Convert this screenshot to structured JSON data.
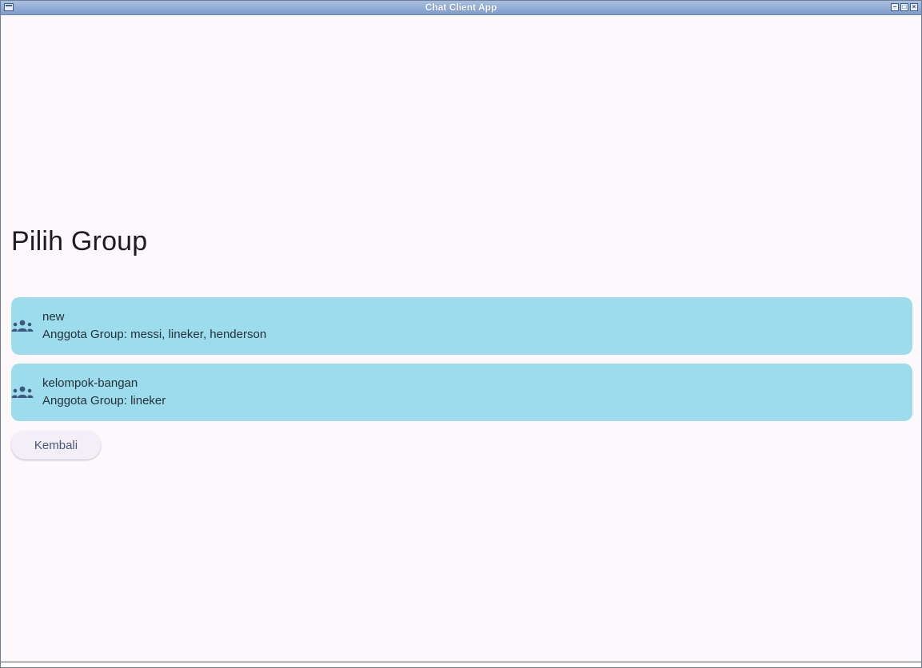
{
  "window": {
    "title": "Chat Client App"
  },
  "page": {
    "title": "Pilih Group"
  },
  "groups": [
    {
      "name": "new",
      "members": "Anggota Group: messi, lineker, henderson",
      "icon": "group-icon"
    },
    {
      "name": "kelompok-bangan",
      "members": "Anggota Group: lineker",
      "icon": "group-icon"
    }
  ],
  "actions": {
    "back_label": "Kembali"
  },
  "colors": {
    "card_background": "#9cdcec",
    "page_background": "#fdf8fc",
    "icon_color": "#3f5680",
    "button_background": "#f3eef8"
  }
}
